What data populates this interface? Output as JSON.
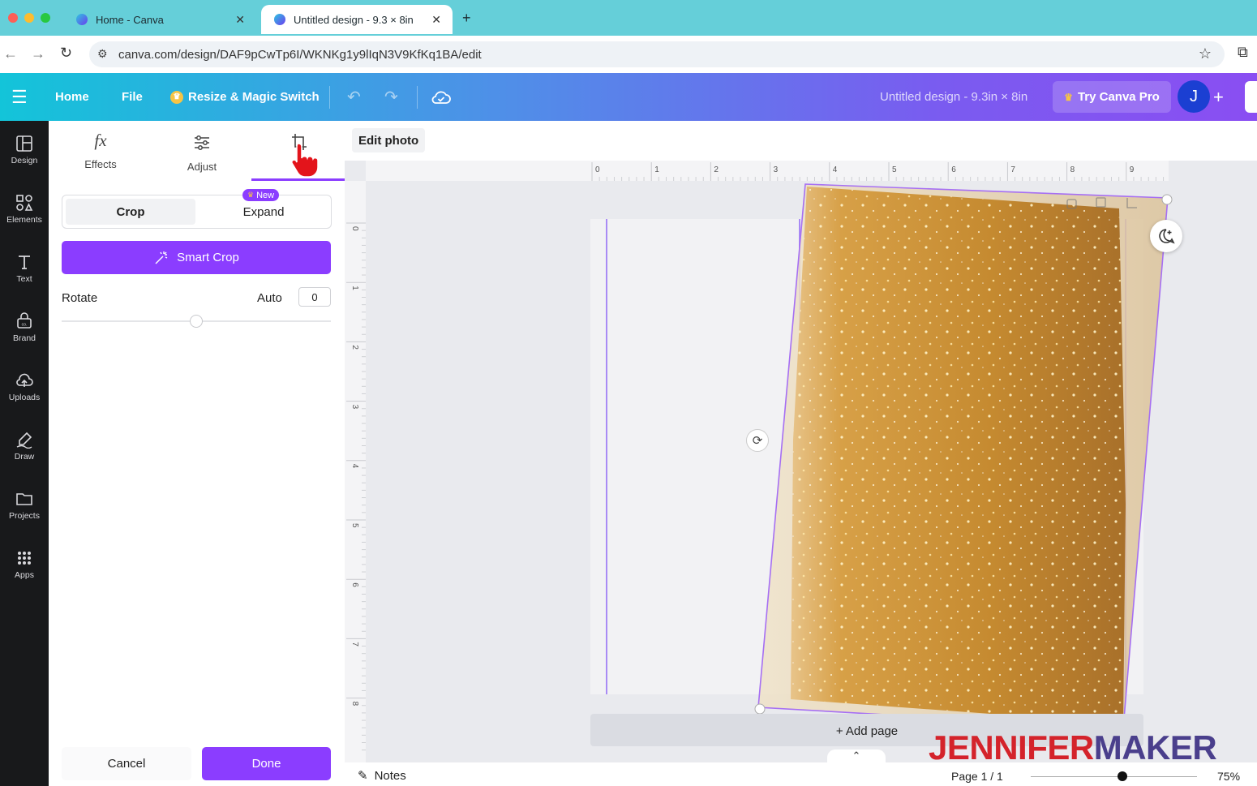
{
  "browser": {
    "tabs": [
      {
        "title": "Home - Canva"
      },
      {
        "title": "Untitled design - 9.3 × 8in"
      }
    ],
    "url": "canva.com/design/DAF9pCwTp6I/WKNKg1y9lIqN3V9KfKq1BA/edit"
  },
  "header": {
    "home": "Home",
    "file": "File",
    "resize": "Resize & Magic Switch",
    "doc_title": "Untitled design - 9.3in × 8in",
    "try_pro": "Try Canva Pro",
    "avatar": "J",
    "plus": "+"
  },
  "rail": {
    "items": [
      {
        "label": "Design",
        "icon": "layout-icon"
      },
      {
        "label": "Elements",
        "icon": "shapes-icon"
      },
      {
        "label": "Text",
        "icon": "text-icon"
      },
      {
        "label": "Brand",
        "icon": "brand-icon"
      },
      {
        "label": "Uploads",
        "icon": "upload-cloud-icon"
      },
      {
        "label": "Draw",
        "icon": "draw-icon"
      },
      {
        "label": "Projects",
        "icon": "folder-icon"
      },
      {
        "label": "Apps",
        "icon": "grid-icon"
      }
    ]
  },
  "panel": {
    "tabs": [
      {
        "label": "Effects"
      },
      {
        "label": "Adjust"
      },
      {
        "label": "Cr"
      }
    ],
    "mode_crop": "Crop",
    "mode_expand": "Expand",
    "new_badge": "New",
    "smart_crop": "Smart Crop",
    "rotate_label": "Rotate",
    "rotate_auto": "Auto",
    "rotate_value": "0",
    "cancel": "Cancel",
    "done": "Done"
  },
  "canvas": {
    "edit_photo": "Edit photo",
    "ruler_top": [
      "0",
      "1",
      "2",
      "3",
      "4",
      "5",
      "6",
      "7",
      "8",
      "9"
    ],
    "ruler_left": [
      "0",
      "1",
      "2",
      "3",
      "4",
      "5",
      "6",
      "7",
      "8"
    ],
    "add_page": "+ Add page"
  },
  "bottom": {
    "notes": "Notes",
    "page": "Page 1 / 1",
    "zoom": "75%",
    "zoom_slider_level": 0.55
  },
  "watermark": "JENNIFERMAKER",
  "colors": {
    "purple": "#8b3dff",
    "teal": "#65cfd9",
    "rail": "#18191b",
    "glitter": "#c8902c"
  }
}
